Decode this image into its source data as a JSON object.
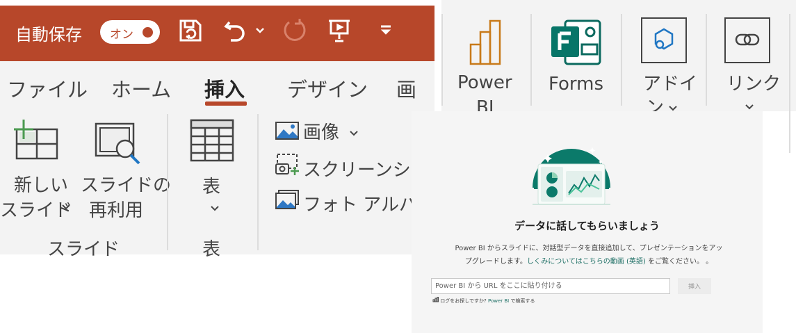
{
  "titlebar": {
    "autosave_label": "自動保存",
    "toggle_label": "オン"
  },
  "tabs": [
    "ファイル",
    "ホーム",
    "挿入",
    "デザイン",
    "画面"
  ],
  "ribbon": {
    "new_slide_line1": "新しい",
    "new_slide_line2": "スライド",
    "reuse_line1": "スライドの",
    "reuse_line2": "再利用",
    "slides_group": "スライド",
    "table_label": "表",
    "table_group": "表",
    "image_label": "画像",
    "screenshot_label": "スクリーンショット",
    "photo_album_label": "フォト アルバム"
  },
  "right_panel": {
    "powerbi_line1": "Power",
    "powerbi_line2": "BI",
    "forms_label": "Forms",
    "addin_line1": "アドイ",
    "addin_line2": "ン",
    "link_label": "リンク"
  },
  "dialog": {
    "title": "データに話してもらいましょう",
    "desc_line1": "Power BI からスライドに、対話型データを直接追加して、プレゼンテーションをアッ",
    "desc_line2_a": "プグレードします。",
    "desc_link": "しくみについてはこちらの動画 (英語)",
    "desc_line2_b": " をご覧ください。 。",
    "input_placeholder": "Power BI から URL をここに貼り付ける",
    "insert_button": "挿入",
    "search_hint_a": "ログをお探しですか?",
    "search_hint_link": " Power BI",
    "search_hint_b": " で検索する"
  },
  "colors": {
    "accent": "#b7472a",
    "teal": "#1e6f65",
    "forms_green": "#077568"
  }
}
